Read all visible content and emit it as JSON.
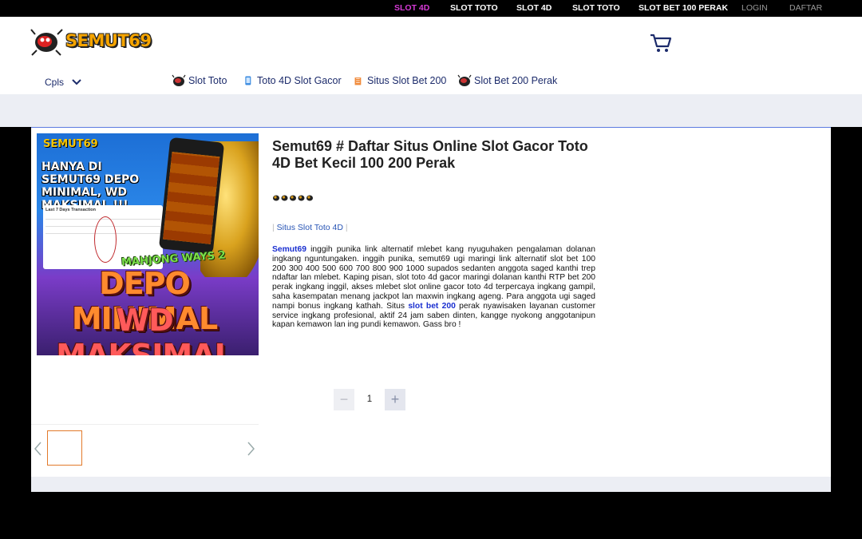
{
  "topnav": {
    "items": [
      {
        "label": "SLOT 4D",
        "state": "active"
      },
      {
        "label": "SLOT TOTO",
        "state": "normal"
      },
      {
        "label": "SLOT 4D",
        "state": "normal"
      },
      {
        "label": "SLOT TOTO",
        "state": "normal"
      },
      {
        "label": "SLOT BET 100 PERAK",
        "state": "normal"
      },
      {
        "label": "LOGIN",
        "state": "muted"
      },
      {
        "label": "DAFTAR",
        "state": "muted"
      }
    ]
  },
  "header": {
    "logo_text": "SEMUT69",
    "cart_icon": "shopping-cart-icon",
    "category_dropdown": "Cpls",
    "nav": [
      {
        "label": "Slot Toto",
        "icon": "ant-mascot-icon"
      },
      {
        "label": "Toto 4D Slot Gacor",
        "icon": "phone-icon"
      },
      {
        "label": "Situs Slot Bet 200",
        "icon": "gift-icon"
      },
      {
        "label": "Slot Bet 200 Perak",
        "icon": "ant-mascot-icon"
      }
    ]
  },
  "product": {
    "banner": {
      "logo": "SEMUT69",
      "headline": "HANYA DI SEMUT69 DEPO MINIMAL, WD MAKSIMAL !!!",
      "table_title": "Last 7 Days Transaction",
      "game": "MAHJONG WAYS 2",
      "slogan_line1": "DEPO MINIMAL",
      "slogan_line2": "WD MAKSIMAL"
    },
    "title": "Semut69 # Daftar Situs Online Slot Gacor Toto 4D Bet Kecil 100 200 Perak",
    "rating_stars": 5,
    "tag": "Situs Slot Toto 4D",
    "tag_separator": "|",
    "description": {
      "lead": "Semut69",
      "part1": " inggih punika link alternatif mlebet kang nyuguhaken pengalaman dolanan ingkang nguntungaken. inggih punika, semut69 ugi maringi link alternatif slot bet 100 200 300 400 500 600 700 800 900 1000 supados sedanten anggota saged kanthi trep ndaftar lan mlebet. Kaping pisan, slot toto 4d gacor maringi dolanan kanthi RTP bet 200 perak ingkang inggil, akses mlebet slot online gacor toto 4d terpercaya ingkang gampil, saha kasempatan menang jackpot lan maxwin ingkang ageng. Para anggota ugi saged nampi bonus ingkang kathah. Situs ",
      "link": "slot bet 200",
      "part2": " perak nyawisaken layanan customer service ingkang profesional, aktif 24 jam saben dinten, kangge nyokong anggotanipun kapan kemawon lan ing pundi kemawon. Gass bro !"
    },
    "quantity": {
      "minus": "−",
      "value": "1",
      "plus": "+"
    }
  },
  "colors": {
    "active_nav": "#d63ad6",
    "nav_text": "#1c2b6b",
    "link": "#1a2fd0",
    "tag": "#2754b5",
    "thumb_border": "#e27a2b"
  }
}
